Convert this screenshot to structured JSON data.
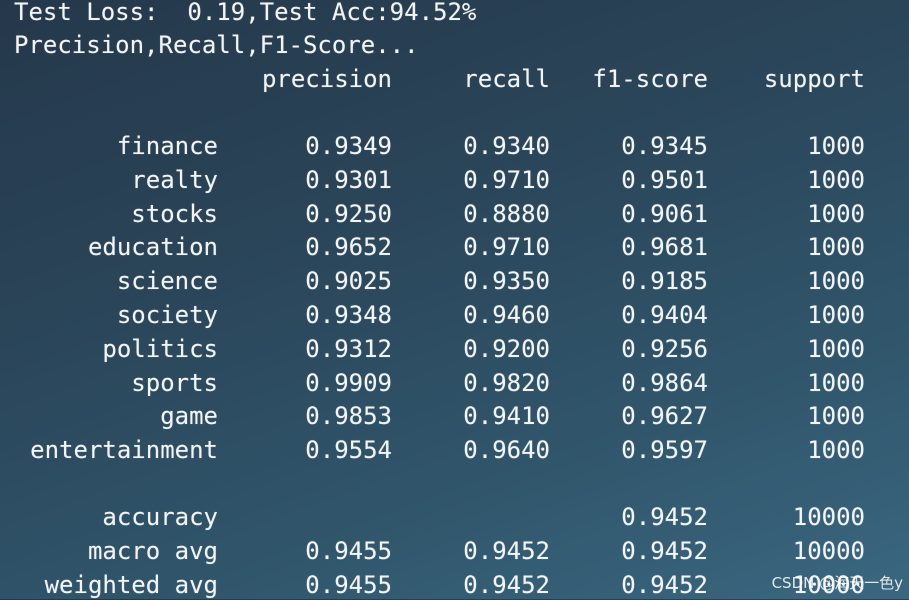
{
  "header": {
    "loss_line": "Test Loss:  0.19,Test Acc:94.52%",
    "metrics_title": "Precision,Recall,F1-Score..."
  },
  "report": {
    "columns": [
      "precision",
      "recall",
      "f1-score",
      "support"
    ],
    "classes": [
      {
        "label": "finance",
        "precision": "0.9349",
        "recall": "0.9340",
        "f1": "0.9345",
        "support": "1000"
      },
      {
        "label": "realty",
        "precision": "0.9301",
        "recall": "0.9710",
        "f1": "0.9501",
        "support": "1000"
      },
      {
        "label": "stocks",
        "precision": "0.9250",
        "recall": "0.8880",
        "f1": "0.9061",
        "support": "1000"
      },
      {
        "label": "education",
        "precision": "0.9652",
        "recall": "0.9710",
        "f1": "0.9681",
        "support": "1000"
      },
      {
        "label": "science",
        "precision": "0.9025",
        "recall": "0.9350",
        "f1": "0.9185",
        "support": "1000"
      },
      {
        "label": "society",
        "precision": "0.9348",
        "recall": "0.9460",
        "f1": "0.9404",
        "support": "1000"
      },
      {
        "label": "politics",
        "precision": "0.9312",
        "recall": "0.9200",
        "f1": "0.9256",
        "support": "1000"
      },
      {
        "label": "sports",
        "precision": "0.9909",
        "recall": "0.9820",
        "f1": "0.9864",
        "support": "1000"
      },
      {
        "label": "game",
        "precision": "0.9853",
        "recall": "0.9410",
        "f1": "0.9627",
        "support": "1000"
      },
      {
        "label": "entertainment",
        "precision": "0.9554",
        "recall": "0.9640",
        "f1": "0.9597",
        "support": "1000"
      }
    ],
    "summary": [
      {
        "label": "accuracy",
        "precision": "",
        "recall": "",
        "f1": "0.9452",
        "support": "10000"
      },
      {
        "label": "macro avg",
        "precision": "0.9455",
        "recall": "0.9452",
        "f1": "0.9452",
        "support": "10000"
      },
      {
        "label": "weighted avg",
        "precision": "0.9455",
        "recall": "0.9452",
        "f1": "0.9452",
        "support": "10000"
      }
    ]
  },
  "watermark": "CSDN @海天一色y"
}
